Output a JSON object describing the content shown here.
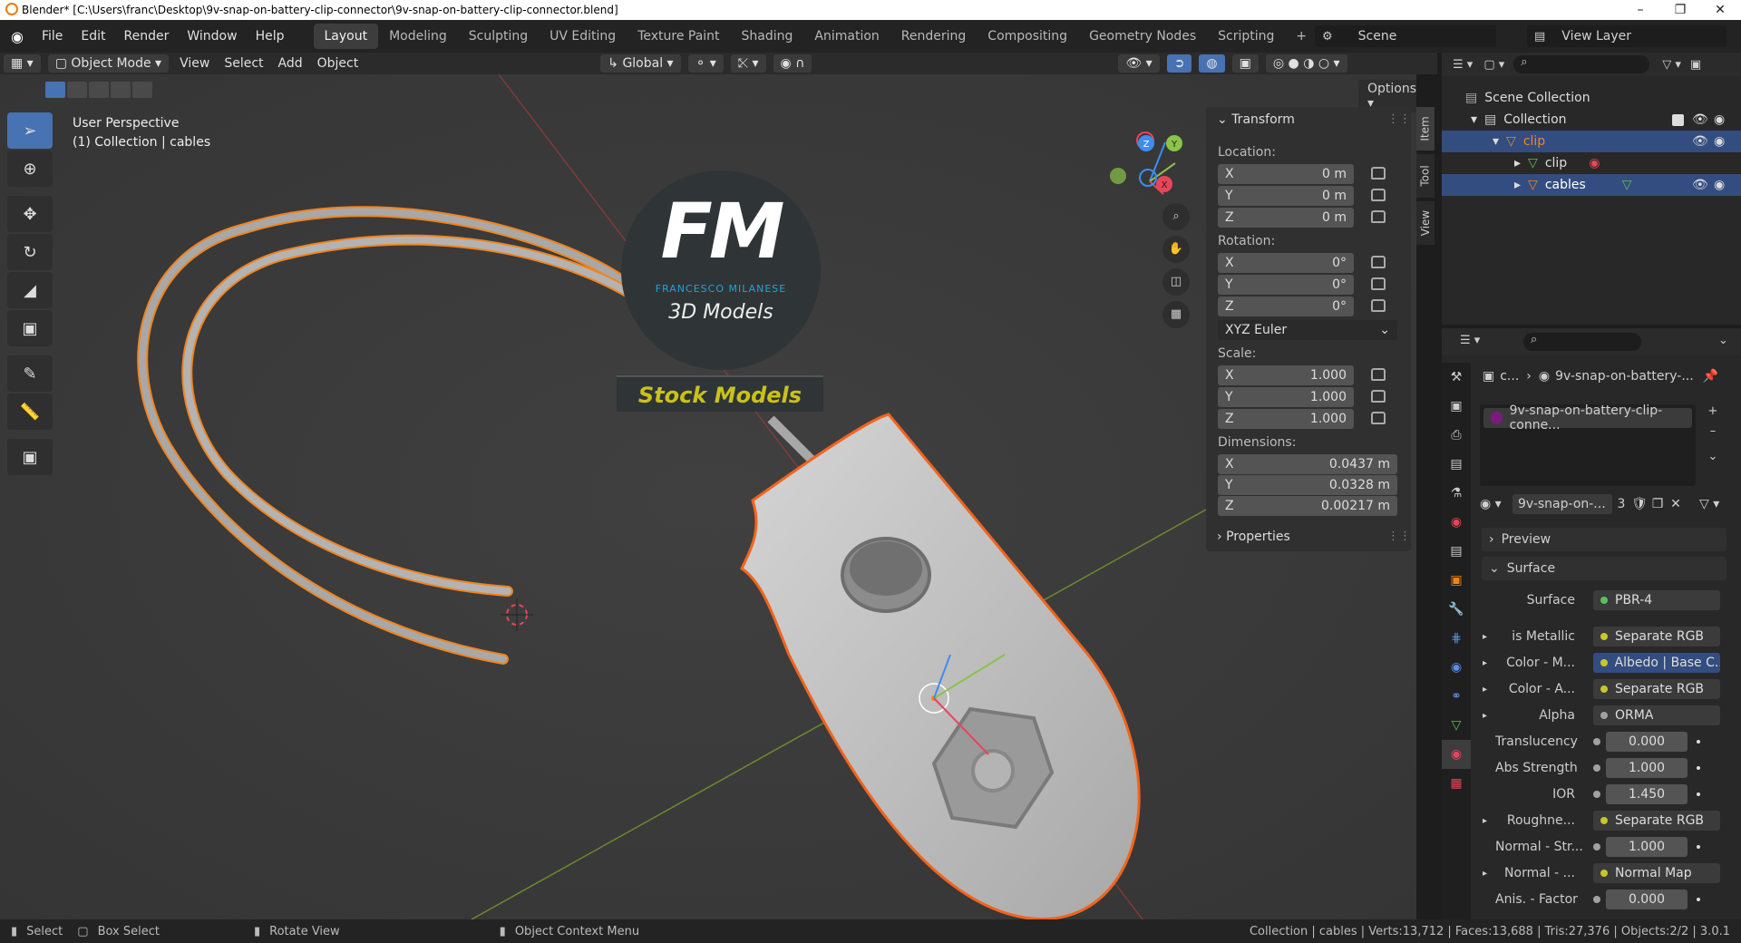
{
  "window": {
    "title": "Blender* [C:\\Users\\franc\\Desktop\\9v-snap-on-battery-clip-connector\\9v-snap-on-battery-clip-connector.blend]"
  },
  "menu": [
    "File",
    "Edit",
    "Render",
    "Window",
    "Help"
  ],
  "workspaces": [
    "Layout",
    "Modeling",
    "Sculpting",
    "UV Editing",
    "Texture Paint",
    "Shading",
    "Animation",
    "Rendering",
    "Compositing",
    "Geometry Nodes",
    "Scripting"
  ],
  "workspace_active": "Layout",
  "scene": {
    "name": "Scene",
    "view_layer": "View Layer"
  },
  "viewport_header": {
    "mode": "Object Mode",
    "menus": [
      "View",
      "Select",
      "Add",
      "Object"
    ],
    "transform_orientation": "Global",
    "options": "Options"
  },
  "viewport": {
    "perspective": "User Perspective",
    "collection_info": "(1) Collection | cables",
    "logo": {
      "initials": "FM",
      "name": "FRANCESCO MILANESE",
      "subtitle": "3D Models",
      "banner": "Stock Models"
    },
    "gizmo_labels": {
      "x": "X",
      "y": "Y",
      "z": "Z"
    }
  },
  "npanel": {
    "section": "Transform",
    "location_label": "Location:",
    "location": [
      {
        "axis": "X",
        "value": "0 m"
      },
      {
        "axis": "Y",
        "value": "0 m"
      },
      {
        "axis": "Z",
        "value": "0 m"
      }
    ],
    "rotation_label": "Rotation:",
    "rotation": [
      {
        "axis": "X",
        "value": "0°"
      },
      {
        "axis": "Y",
        "value": "0°"
      },
      {
        "axis": "Z",
        "value": "0°"
      }
    ],
    "rotation_mode": "XYZ Euler",
    "scale_label": "Scale:",
    "scale": [
      {
        "axis": "X",
        "value": "1.000"
      },
      {
        "axis": "Y",
        "value": "1.000"
      },
      {
        "axis": "Z",
        "value": "1.000"
      }
    ],
    "dimensions_label": "Dimensions:",
    "dimensions": [
      {
        "axis": "X",
        "value": "0.0437 m"
      },
      {
        "axis": "Y",
        "value": "0.0328 m"
      },
      {
        "axis": "Z",
        "value": "0.00217 m"
      }
    ],
    "properties_section": "Properties",
    "tabs": [
      "Item",
      "Tool",
      "View"
    ]
  },
  "outliner": {
    "rows": [
      {
        "label": "Scene Collection"
      },
      {
        "label": "Collection"
      },
      {
        "label": "clip"
      },
      {
        "label": "clip"
      },
      {
        "label": "cables"
      }
    ]
  },
  "properties": {
    "breadcrumb_short": "c...",
    "breadcrumb_material": "9v-snap-on-battery-...",
    "material_slot": "9v-snap-on-battery-clip-conne...",
    "material_name": "9v-snap-on-...",
    "material_users": "3",
    "preview_section": "Preview",
    "surface_section": "Surface",
    "rows": [
      {
        "label": "Surface",
        "value": "PBR-4",
        "kind": "link",
        "sock": "#5cbf5c"
      },
      {
        "label": "is Metallic",
        "value": "Separate RGB",
        "kind": "link",
        "sock": "#c7c729",
        "expand": true
      },
      {
        "label": "Color - M...",
        "value": "Albedo | Base C...",
        "kind": "link",
        "sock": "#c7c729",
        "expand": true,
        "hl": true
      },
      {
        "label": "Color - A...",
        "value": "Separate RGB",
        "kind": "link",
        "sock": "#c7c729",
        "expand": true
      },
      {
        "label": "Alpha",
        "value": "ORMA",
        "kind": "link",
        "sock": "#a1a1a1",
        "expand": true
      },
      {
        "label": "Translucency",
        "value": "0.000",
        "kind": "num",
        "sock": "#a1a1a1"
      },
      {
        "label": "Abs Strength",
        "value": "1.000",
        "kind": "num",
        "sock": "#a1a1a1"
      },
      {
        "label": "IOR",
        "value": "1.450",
        "kind": "num",
        "sock": "#a1a1a1"
      },
      {
        "label": "Roughne...",
        "value": "Separate RGB",
        "kind": "link",
        "sock": "#c7c729",
        "expand": true
      },
      {
        "label": "Normal - Str...",
        "value": "1.000",
        "kind": "num",
        "sock": "#a1a1a1"
      },
      {
        "label": "Normal - ...",
        "value": "Normal Map",
        "kind": "link",
        "sock": "#c7c729",
        "expand": true
      },
      {
        "label": "Anis. - Factor",
        "value": "0.000",
        "kind": "num",
        "sock": "#a1a1a1"
      }
    ]
  },
  "statusbar": {
    "select": "Select",
    "box_select": "Box Select",
    "rotate_view": "Rotate View",
    "context_menu": "Object Context Menu",
    "stats": "Collection | cables | Verts:13,712 | Faces:13,688 | Tris:27,376 | Objects:2/2 | 3.0.1"
  },
  "colors": {
    "accent": "#4772b3",
    "selection_orange": "#f2841d",
    "x_axis": "#e94559",
    "y_axis": "#8bc34a",
    "z_axis": "#3b8ef2",
    "logo_blue": "#1fa5d8",
    "logo_yellow": "#c9c21a"
  }
}
